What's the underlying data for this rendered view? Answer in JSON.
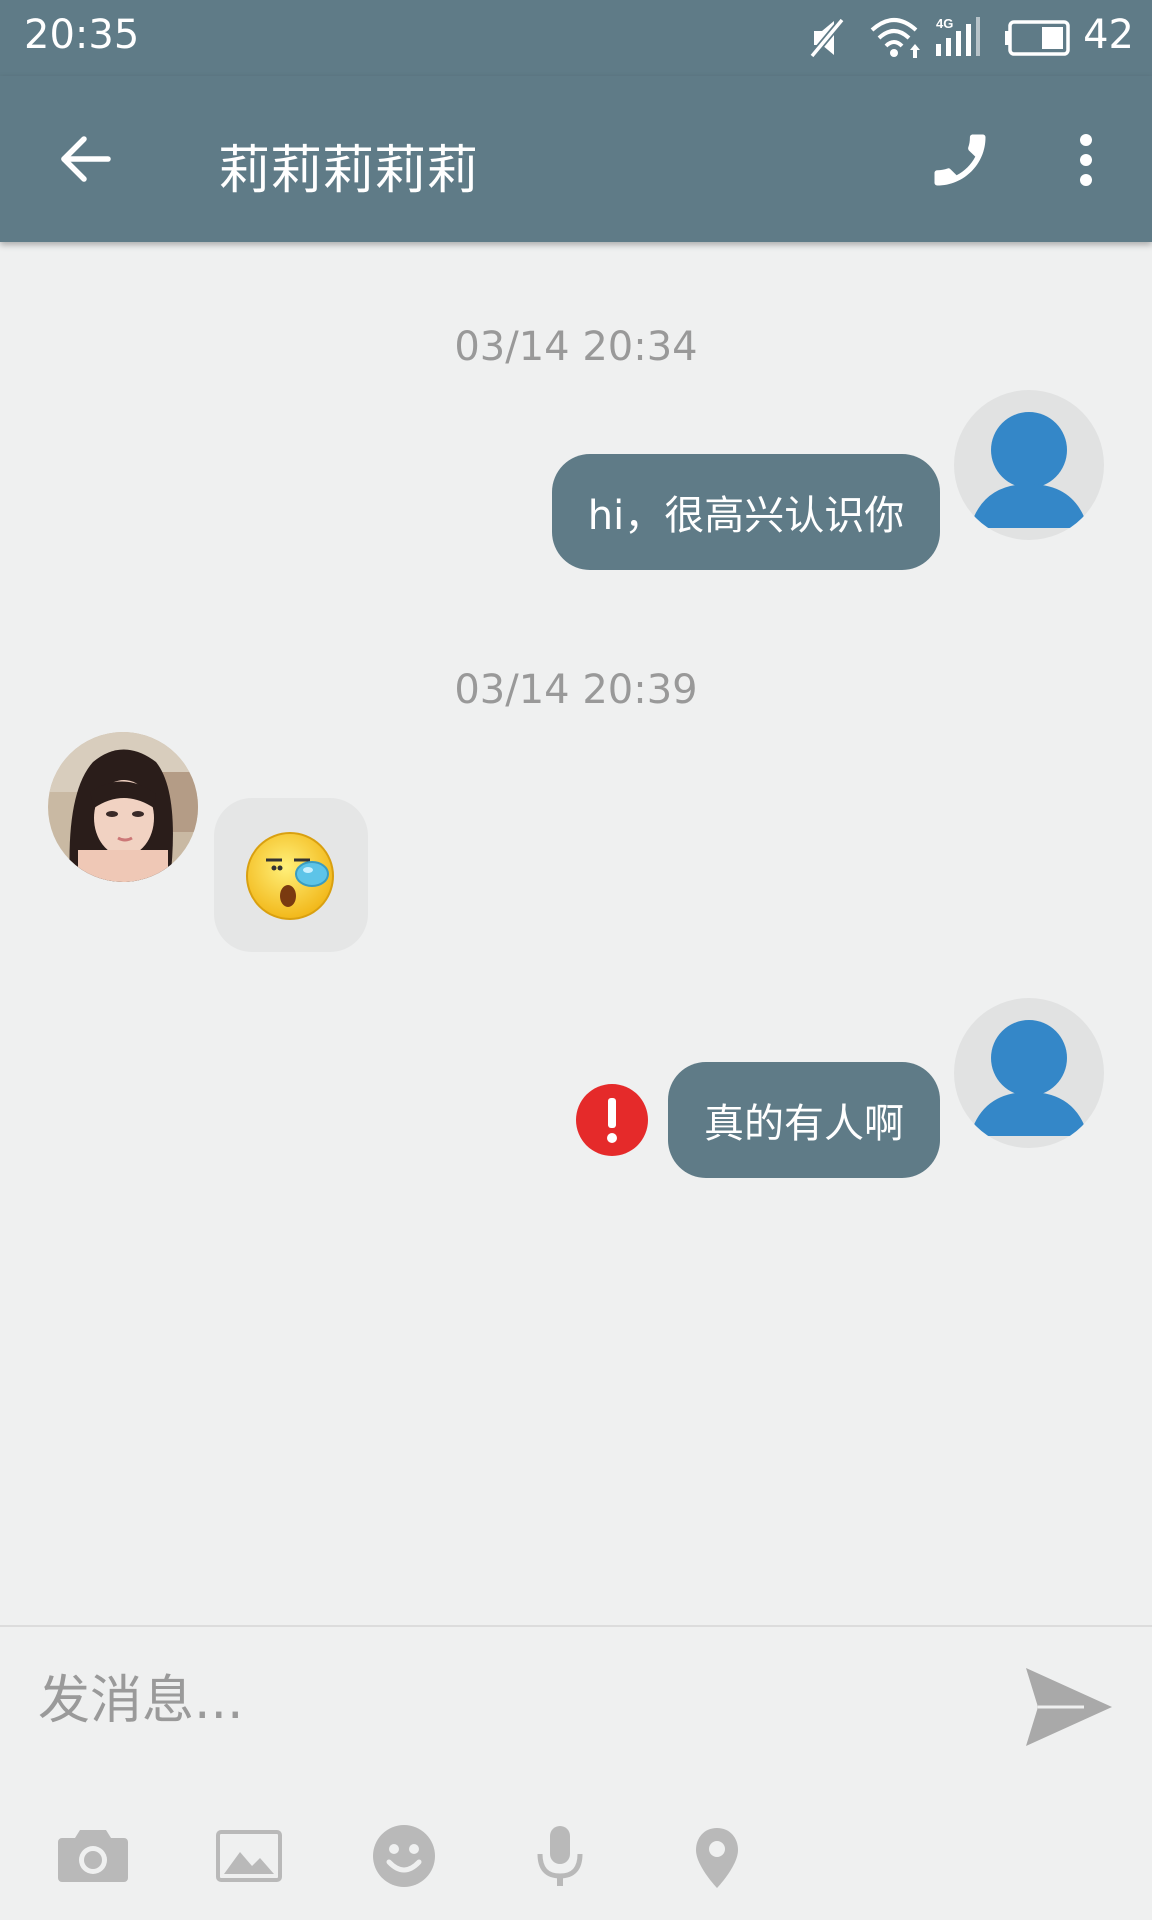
{
  "status_bar": {
    "time": "20:35",
    "battery_level": "42",
    "icons": [
      "mute-icon",
      "wifi-icon",
      "signal-4g-icon",
      "battery-icon"
    ]
  },
  "header": {
    "title": "莉莉莉莉莉",
    "back_icon": "arrow-left-icon",
    "call_icon": "phone-icon",
    "menu_icon": "more-vert-icon"
  },
  "messages": [
    {
      "timestamp": "03/14 20:34",
      "direction": "outgoing",
      "text": "hi，很高兴认识你",
      "failed": false
    },
    {
      "timestamp": "03/14 20:39",
      "direction": "incoming",
      "sticker": "sleepy-face-emoji"
    },
    {
      "direction": "outgoing",
      "text": "真的有人啊",
      "failed": true
    }
  ],
  "composer": {
    "placeholder": "发消息...",
    "send_icon": "send-icon",
    "tools": [
      "camera-icon",
      "image-icon",
      "emoji-icon",
      "microphone-icon",
      "location-icon"
    ]
  },
  "colors": {
    "primary": "#5f7b87",
    "background": "#eff0f0",
    "avatar_blue": "#3487c8",
    "error_red": "#e52a2a",
    "icon_gray": "#b9b9b9"
  }
}
